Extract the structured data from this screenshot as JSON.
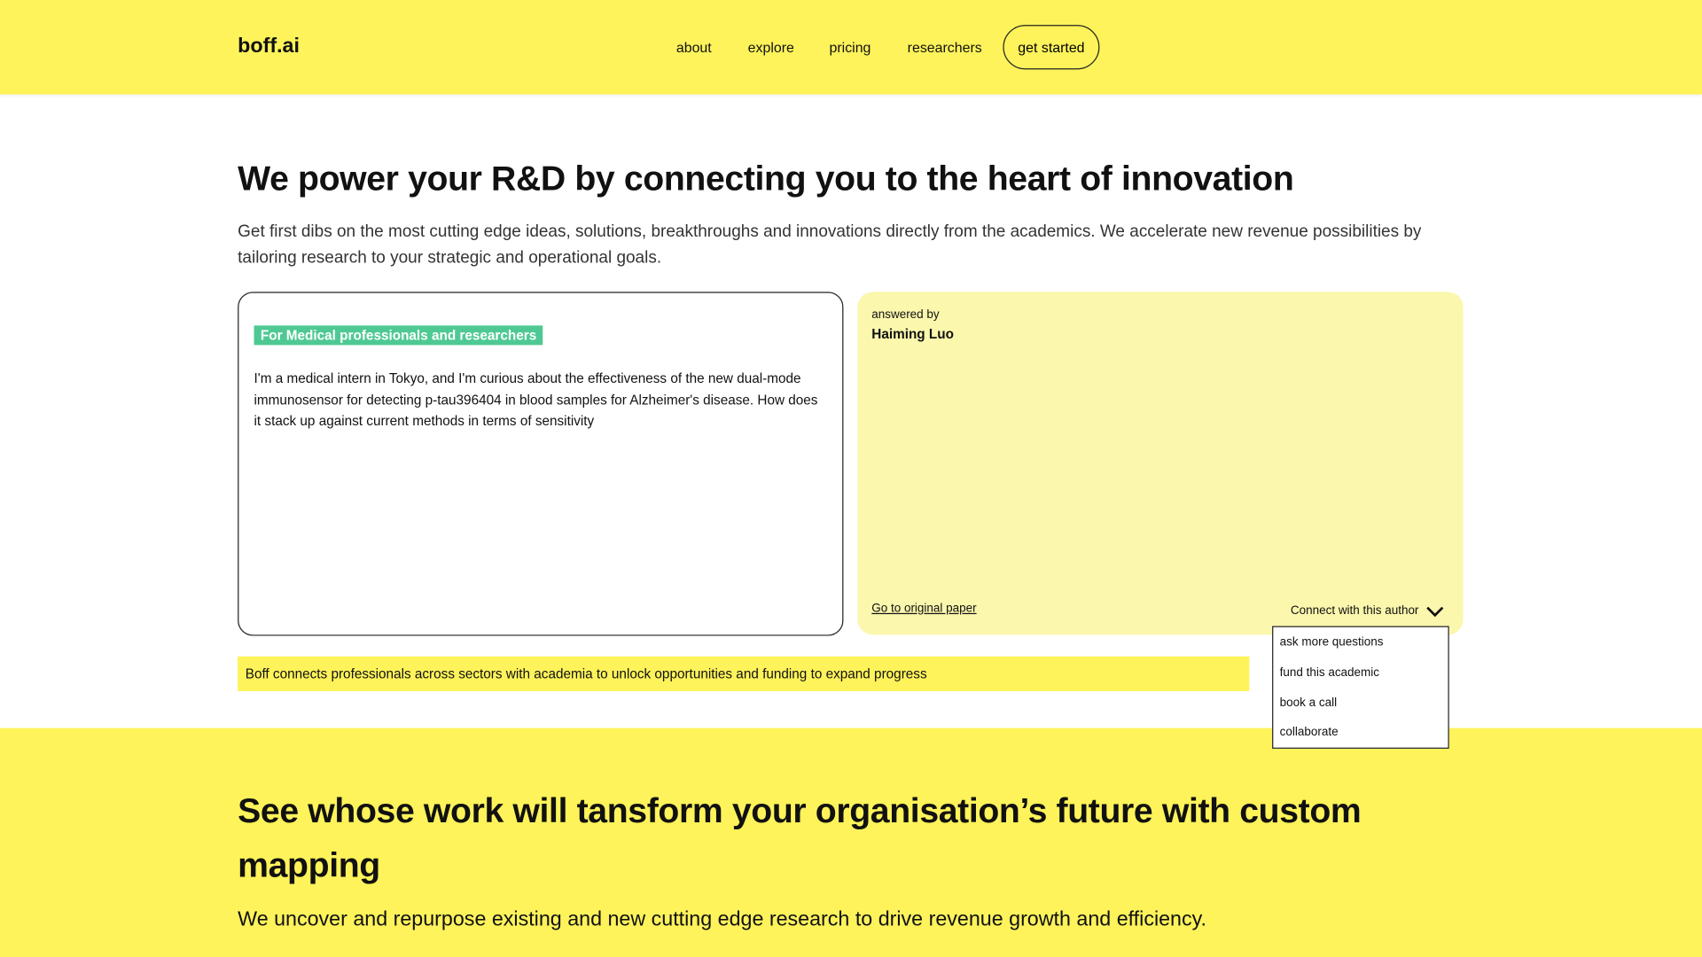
{
  "header": {
    "logo": "boff.ai",
    "nav": [
      "about",
      "explore",
      "pricing",
      "researchers"
    ],
    "cta": "get started"
  },
  "hero": {
    "title": "We power your R&D by connecting you to the heart of innovation",
    "lead": "Get first dibs on the most cutting edge ideas, solutions, breakthroughs and innovations directly from the academics. We accelerate new revenue possibilities by tailoring research to your strategic and operational goals."
  },
  "question": {
    "badge": "For Medical professionals and researchers",
    "text": " I'm a medical intern in Tokyo, and I'm curious about the effectiveness of the new dual-mode immunosensor for detecting p-tau396404 in blood samples for Alzheimer's disease. How does it stack up against current methods in terms of sensitivity"
  },
  "answer": {
    "answered_by_label": "answered by",
    "author": "Haiming Luo",
    "paper_link": "Go to original paper",
    "connect_label": "Connect with this author",
    "connect_icon": "chevron-down-icon",
    "menu": [
      "ask more questions",
      "fund this academic",
      "book a call",
      "collaborate"
    ]
  },
  "strip": "Boff connects professionals across sectors with academia to unlock opportunities and funding to expand progress",
  "mapping": {
    "title": "See whose work will tansform your organisation’s future with custom mapping",
    "subtitle": "We uncover and repurpose existing and new cutting edge research to drive revenue growth and efficiency."
  },
  "colors": {
    "yellow": "#fef35a",
    "card_yellow": "#fbf7ad",
    "badge_green": "#4fc993"
  }
}
